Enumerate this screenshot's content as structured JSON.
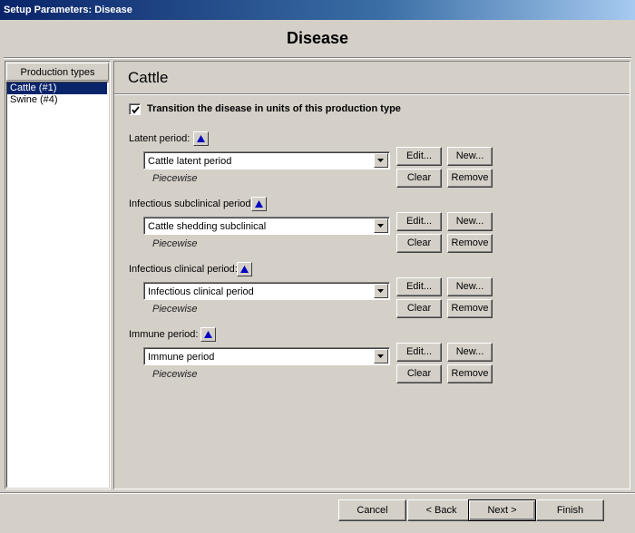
{
  "window": {
    "title": "Setup Parameters: Disease"
  },
  "header": {
    "title": "Disease"
  },
  "production_types": {
    "header": "Production types",
    "items": [
      {
        "label": "Cattle (#1)",
        "selected": true
      },
      {
        "label": "Swine (#4)",
        "selected": false
      }
    ]
  },
  "panel": {
    "title": "Cattle",
    "transition_checkbox": {
      "label": "Transition the disease in units of this production type",
      "checked": true
    },
    "sections": [
      {
        "label": "Latent period:",
        "value": "Cattle latent period",
        "type": "Piecewise"
      },
      {
        "label": "Infectious subclinical period:",
        "value": "Cattle shedding subclinical",
        "type": "Piecewise"
      },
      {
        "label": "Infectious clinical period:",
        "value": "Infectious clinical period",
        "type": "Piecewise"
      },
      {
        "label": "Immune period:",
        "value": "Immune period",
        "type": "Piecewise"
      }
    ],
    "buttons": {
      "edit": "Edit...",
      "new": "New...",
      "clear": "Clear",
      "remove": "Remove"
    }
  },
  "footer": {
    "cancel": "Cancel",
    "back": "< Back",
    "next": "Next >",
    "finish": "Finish"
  },
  "colors": {
    "selection": "#0a246a",
    "face": "#d4d0c8",
    "triangle": "#0000c0"
  }
}
